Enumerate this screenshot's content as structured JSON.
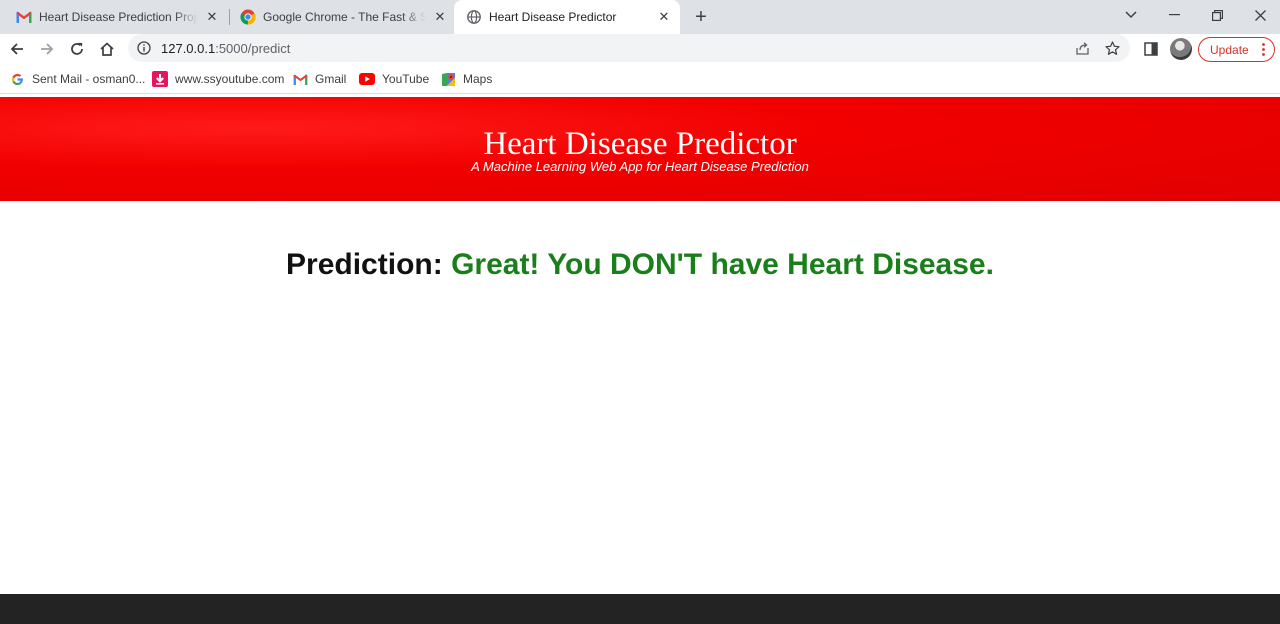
{
  "browser": {
    "tabs": [
      {
        "title": "Heart Disease Prediction Project",
        "icon": "gmail-icon",
        "active": false
      },
      {
        "title": "Google Chrome - The Fast & Secure Web Browser",
        "icon": "chrome-icon",
        "active": false
      },
      {
        "title": "Heart Disease Predictor",
        "icon": "globe-icon",
        "active": true
      }
    ],
    "address": {
      "host": "127.0.0.1",
      "path": ":5000/predict"
    },
    "update_label": "Update",
    "bookmarks": [
      {
        "label": "Sent Mail - osman0...",
        "icon": "google-icon"
      },
      {
        "label": "www.ssyoutube.com",
        "icon": "ssyoutube-icon"
      },
      {
        "label": "Gmail",
        "icon": "gmail-icon"
      },
      {
        "label": "YouTube",
        "icon": "youtube-icon"
      },
      {
        "label": "Maps",
        "icon": "maps-icon"
      }
    ]
  },
  "page": {
    "header": {
      "title": "Heart Disease Predictor",
      "subtitle": "A Machine Learning Web App for Heart Disease Prediction"
    },
    "result": {
      "label": "Prediction:",
      "value": "Great! You DON'T have Heart Disease."
    }
  },
  "colors": {
    "header_red": "#f20000",
    "result_green": "#1a7f1a",
    "update_red": "#d93025",
    "footer": "#232323"
  }
}
